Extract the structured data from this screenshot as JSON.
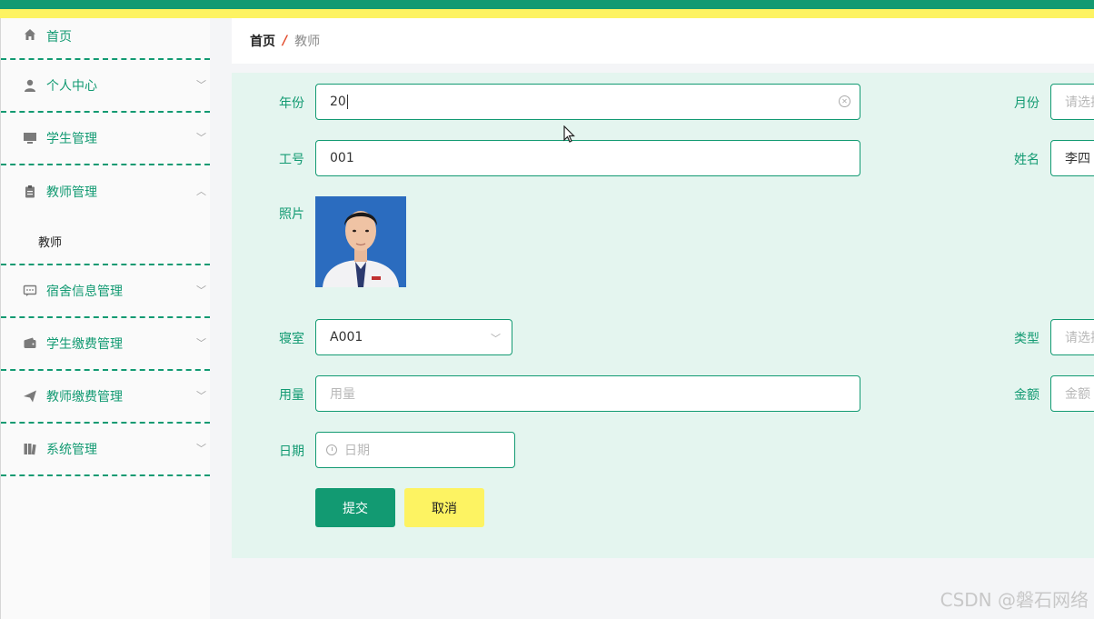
{
  "sidebar": {
    "items": [
      {
        "label": "首页",
        "icon": "home-icon"
      },
      {
        "label": "个人中心",
        "icon": "user-icon"
      },
      {
        "label": "学生管理",
        "icon": "monitor-icon"
      },
      {
        "label": "教师管理",
        "icon": "clipboard-icon"
      },
      {
        "label": "宿舍信息管理",
        "icon": "chat-icon"
      },
      {
        "label": "学生缴费管理",
        "icon": "wallet-icon"
      },
      {
        "label": "教师缴费管理",
        "icon": "send-icon"
      },
      {
        "label": "系统管理",
        "icon": "book-icon"
      }
    ],
    "submenu_teacher": "教师"
  },
  "breadcrumb": {
    "home": "首页",
    "separator": "/",
    "current": "教师"
  },
  "form": {
    "year": {
      "label": "年份",
      "value": "20"
    },
    "month": {
      "label": "月份",
      "placeholder": "请选择"
    },
    "staff_id": {
      "label": "工号",
      "value": "001"
    },
    "name": {
      "label": "姓名",
      "value": "李四"
    },
    "photo": {
      "label": "照片"
    },
    "dorm": {
      "label": "寝室",
      "value": "A001"
    },
    "type": {
      "label": "类型",
      "placeholder": "请选择"
    },
    "usage": {
      "label": "用量",
      "placeholder": "用量"
    },
    "amount": {
      "label": "金额",
      "placeholder": "金额"
    },
    "date": {
      "label": "日期",
      "placeholder": "日期"
    },
    "submit_label": "提交",
    "cancel_label": "取消"
  },
  "watermark": "CSDN @磐石网络",
  "colors": {
    "primary": "#129a72",
    "accent_yellow": "#fdf362",
    "form_bg": "#e4f5ef",
    "breadcrumb_sep": "#e24c2d"
  }
}
